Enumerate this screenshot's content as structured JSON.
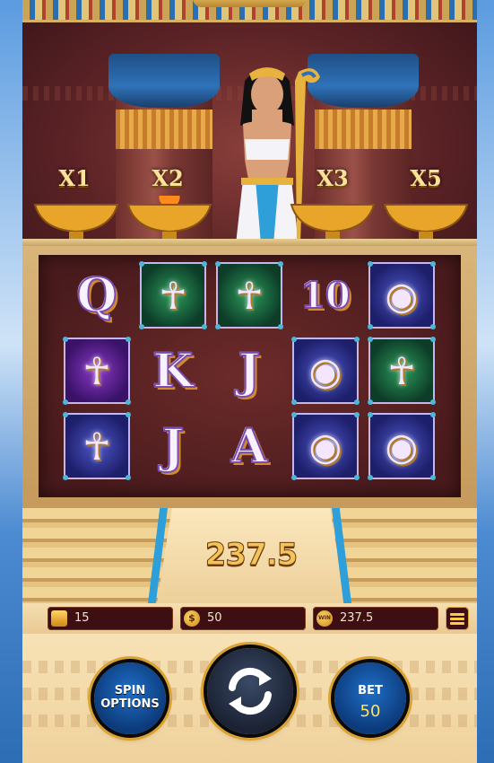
{
  "multipliers": [
    "X1",
    "X2",
    "X3",
    "X5"
  ],
  "reels": {
    "rows": [
      [
        {
          "symbol": "Q",
          "kind": "letter"
        },
        {
          "symbol": "ankh-green",
          "kind": "tile",
          "color": "green"
        },
        {
          "symbol": "ankh-green",
          "kind": "tile",
          "color": "green"
        },
        {
          "symbol": "10",
          "kind": "letter"
        },
        {
          "symbol": "eye-of-horus",
          "kind": "tile",
          "color": "blue"
        }
      ],
      [
        {
          "symbol": "scarab-purple",
          "kind": "tile",
          "color": "purple"
        },
        {
          "symbol": "K",
          "kind": "letter"
        },
        {
          "symbol": "J",
          "kind": "letter"
        },
        {
          "symbol": "eye-of-horus",
          "kind": "tile",
          "color": "blue"
        },
        {
          "symbol": "ankh-green",
          "kind": "tile",
          "color": "green"
        }
      ],
      [
        {
          "symbol": "ankh-blue",
          "kind": "tile",
          "color": "blue"
        },
        {
          "symbol": "J",
          "kind": "letter"
        },
        {
          "symbol": "A",
          "kind": "letter"
        },
        {
          "symbol": "eye-of-horus",
          "kind": "tile",
          "color": "blue"
        },
        {
          "symbol": "eye-of-horus",
          "kind": "tile",
          "color": "blue"
        }
      ]
    ]
  },
  "win_amount": "237.5",
  "info_bar": {
    "balance": "15",
    "balance_icon": "wallet-icon",
    "bet_value": "50",
    "bet_icon": "coin-icon",
    "bet_icon_text": "$",
    "win_value": "237.5",
    "win_icon_text": "WIN",
    "menu_icon": "menu-icon"
  },
  "controls": {
    "spin_options_label_1": "SPIN",
    "spin_options_label_2": "OPTIONS",
    "spin_icon": "refresh-icon",
    "bet_label": "BET",
    "bet_amount": "50"
  },
  "colors": {
    "accent_gold": "#d9a233",
    "button_blue": "#1f6fc7",
    "bet_yellow": "#ffe45a",
    "temple_red": "#5c2326"
  }
}
